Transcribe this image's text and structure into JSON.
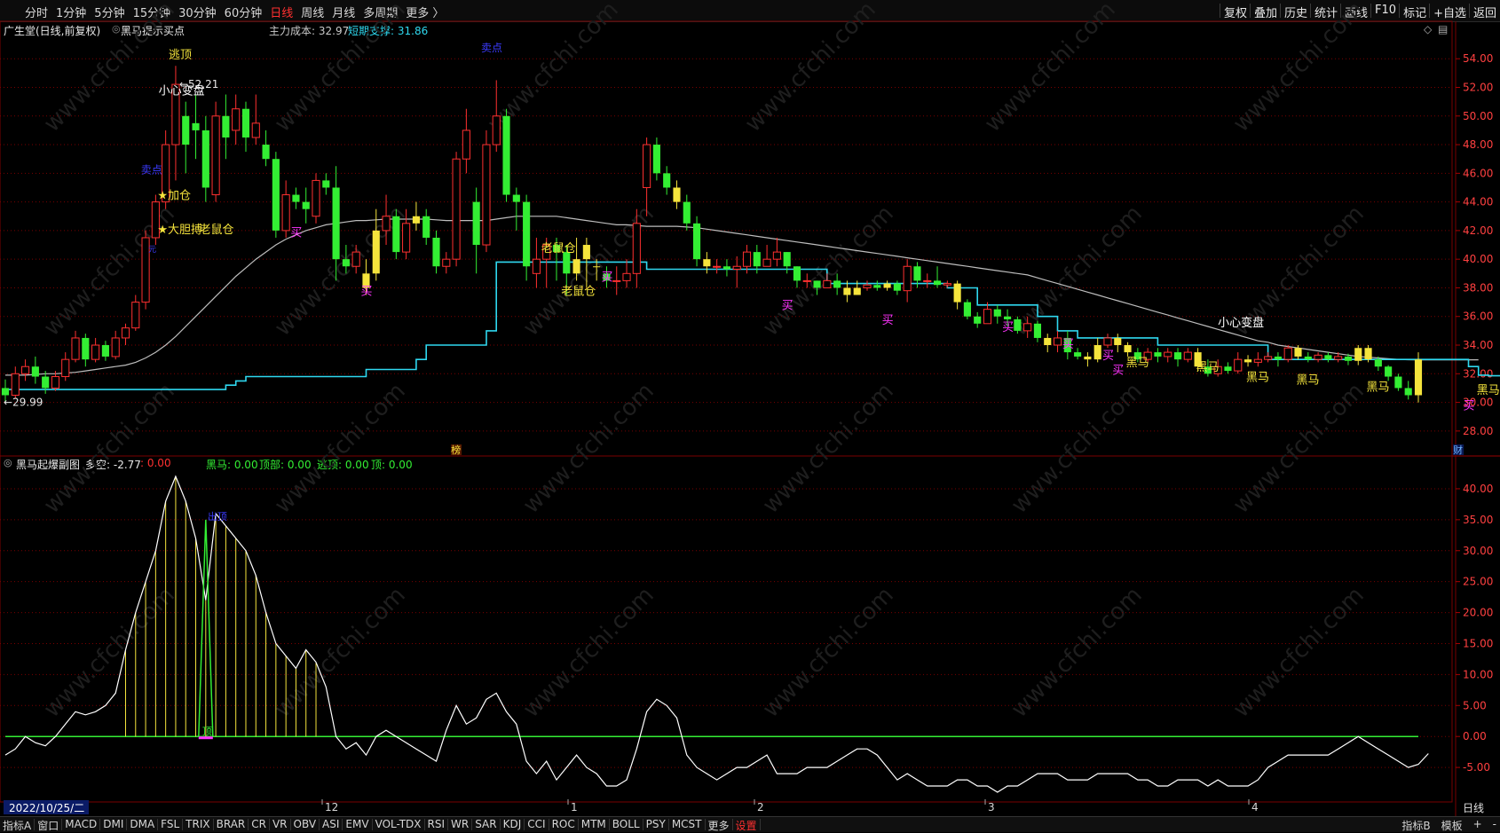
{
  "toolbar": {
    "periods": [
      "分时",
      "1分钟",
      "5分钟",
      "15分钟",
      "30分钟",
      "60分钟",
      "日线",
      "周线",
      "月线",
      "多周期",
      "更多 〉"
    ],
    "active_period": "日线",
    "right_buttons": [
      "复权",
      "叠加",
      "历史",
      "统计",
      "画线",
      "F10",
      "标记",
      "+自选",
      "返回"
    ]
  },
  "main_panel": {
    "stock_title": "广生堂(日线,前复权)",
    "indicator_name": "黑马提示买点",
    "cost_label": "主力成本: 32.97",
    "support_label": "短期支撑: 31.86",
    "price_high_marker": "52.21",
    "price_low_marker": "29.99"
  },
  "sub_panel": {
    "title": "黑马起爆副图",
    "duokong_label": "多空: -2.77",
    "zero_value": ": 0.00",
    "heima": "黑马: 0.00",
    "dingbu": "顶部: 0.00",
    "taoding": "逃顶: 0.00",
    "ding": "顶: 0.00"
  },
  "colors": {
    "up": "#ff3030",
    "down": "#33ee33",
    "yellow": "#f5e43c",
    "ma": "#bdbdbd",
    "support": "#2fd8ef",
    "grid": "#7a0000",
    "bg": "#000000"
  },
  "annotations": {
    "taoding": "逃顶",
    "xiaoxin": "小心变盘",
    "jiacang": "★加仓",
    "dadan": "★大胆搏",
    "laoshu": "老鼠仓",
    "mai": "买",
    "heima": "黑马",
    "maidian": "卖点",
    "yuan": "元",
    "bang": "榜",
    "cai": "财",
    "chuding": "出顶",
    "ding": "顶"
  },
  "xaxis": {
    "date_label": "2022/10/25/二",
    "months": [
      "12",
      "1",
      "2",
      "3",
      "4"
    ],
    "period_label": "日线"
  },
  "bottom_tabs": [
    "指标A",
    "窗口",
    "MACD",
    "DMI",
    "DMA",
    "FSL",
    "TRIX",
    "BRAR",
    "CR",
    "VR",
    "OBV",
    "ASI",
    "EMV",
    "VOL-TDX",
    "RSI",
    "WR",
    "SAR",
    "KDJ",
    "CCI",
    "ROC",
    "MTM",
    "BOLL",
    "PSY",
    "MCST",
    "更多",
    "设置"
  ],
  "bottom_right": [
    "指标B",
    "模板",
    "+",
    "-"
  ],
  "watermark": "www.cfchi.com",
  "chart_data": {
    "type": "candlestick",
    "price_axis": {
      "min": 27,
      "max": 55.5,
      "ticks": [
        28,
        30,
        32,
        34,
        36,
        38,
        40,
        42,
        44,
        46,
        48,
        50,
        52,
        54
      ]
    },
    "indicator_axis": {
      "min": -10,
      "max": 43,
      "ticks": [
        -5,
        0,
        5,
        10,
        15,
        20,
        25,
        30,
        35,
        40
      ]
    },
    "candles": [
      [
        31.0,
        30.5,
        31.6,
        29.99
      ],
      [
        30.5,
        32.0,
        32.5,
        30.3
      ],
      [
        32.0,
        32.5,
        33.0,
        31.5
      ],
      [
        32.5,
        31.8,
        33.2,
        31.3
      ],
      [
        31.8,
        31.0,
        32.2,
        30.6
      ],
      [
        31.0,
        31.8,
        32.2,
        30.8
      ],
      [
        31.8,
        33.0,
        33.5,
        31.5
      ],
      [
        33.0,
        34.5,
        35.0,
        32.8
      ],
      [
        34.5,
        33.0,
        34.8,
        32.5
      ],
      [
        33.0,
        34.0,
        34.5,
        32.8
      ],
      [
        34.0,
        33.2,
        34.3,
        32.9
      ],
      [
        33.2,
        34.5,
        35.0,
        33.0
      ],
      [
        34.5,
        35.2,
        35.5,
        34.0
      ],
      [
        35.2,
        37.0,
        37.5,
        35.0
      ],
      [
        37.0,
        41.5,
        42.0,
        36.5
      ],
      [
        41.5,
        44.0,
        44.5,
        41.0
      ],
      [
        44.0,
        48.0,
        49.0,
        43.5
      ],
      [
        48.0,
        52.21,
        53.5,
        45.5
      ],
      [
        50.0,
        48.0,
        51.0,
        46.0
      ],
      [
        49.5,
        49.0,
        51.5,
        47.0
      ],
      [
        49.0,
        45.0,
        50.0,
        44.0
      ],
      [
        44.5,
        50.0,
        51.0,
        44.0
      ],
      [
        50.0,
        48.5,
        51.5,
        47.0
      ],
      [
        49.0,
        50.5,
        51.5,
        48.0
      ],
      [
        50.5,
        48.5,
        51.0,
        47.5
      ],
      [
        48.5,
        49.5,
        51.5,
        48.0
      ],
      [
        48.0,
        47.0,
        49.0,
        46.5
      ],
      [
        47.0,
        42.0,
        47.5,
        41.5
      ],
      [
        42.0,
        44.5,
        45.5,
        41.5
      ],
      [
        44.5,
        44.0,
        45.0,
        43.5
      ],
      [
        44.0,
        43.5,
        45.0,
        42.5
      ],
      [
        43.0,
        45.5,
        46.0,
        42.5
      ],
      [
        45.5,
        45.0,
        46.0,
        44.5
      ],
      [
        45.0,
        40.0,
        46.5,
        38.5
      ],
      [
        40.0,
        39.5,
        41.0,
        39.0
      ],
      [
        39.5,
        40.5,
        41.0,
        39.0
      ],
      [
        38.0,
        39.0,
        40.0,
        37.5
      ],
      [
        39.0,
        42.0,
        43.5,
        38.5
      ],
      [
        42.0,
        43.0,
        44.5,
        41.0
      ],
      [
        43.0,
        40.5,
        43.5,
        40.0
      ],
      [
        40.5,
        42.5,
        43.5,
        40.0
      ],
      [
        42.5,
        43.0,
        44.0,
        42.0
      ],
      [
        43.0,
        41.5,
        43.5,
        41.0
      ],
      [
        41.5,
        39.5,
        42.0,
        39.0
      ],
      [
        39.5,
        40.0,
        40.5,
        39.0
      ],
      [
        40.0,
        47.0,
        47.5,
        39.5
      ],
      [
        47.0,
        49.0,
        50.5,
        46.0
      ],
      [
        44.0,
        41.0,
        45.0,
        39.0
      ],
      [
        41.0,
        48.0,
        49.0,
        40.5
      ],
      [
        48.0,
        50.0,
        52.5,
        47.5
      ],
      [
        50.0,
        44.5,
        50.5,
        44.0
      ],
      [
        44.5,
        44.0,
        45.0,
        42.0
      ],
      [
        44.0,
        39.5,
        44.5,
        38.5
      ],
      [
        39.0,
        40.0,
        41.5,
        38.0
      ],
      [
        40.0,
        41.0,
        41.5,
        38.0
      ],
      [
        41.0,
        40.5,
        41.5,
        38.5
      ],
      [
        40.5,
        39.0,
        41.0,
        37.5
      ],
      [
        39.0,
        40.0,
        41.5,
        38.5
      ],
      [
        40.0,
        41.0,
        41.5,
        38.0
      ],
      [
        39.5,
        39.5,
        40.0,
        38.5
      ],
      [
        39.0,
        38.5,
        39.5,
        38.0
      ],
      [
        38.5,
        38.5,
        39.5,
        37.5
      ],
      [
        38.5,
        39.0,
        40.0,
        38.0
      ],
      [
        39.0,
        42.5,
        43.5,
        38.0
      ],
      [
        45.0,
        48.0,
        48.5,
        43.0
      ],
      [
        48.0,
        46.0,
        48.5,
        45.5
      ],
      [
        46.0,
        45.0,
        46.5,
        44.5
      ],
      [
        45.0,
        44.0,
        45.5,
        43.5
      ],
      [
        44.0,
        42.5,
        44.5,
        42.0
      ],
      [
        42.5,
        40.0,
        43.0,
        39.5
      ],
      [
        40.0,
        39.5,
        40.5,
        39.0
      ],
      [
        39.5,
        39.5,
        40.0,
        39.0
      ],
      [
        39.5,
        39.3,
        40.0,
        38.8
      ],
      [
        39.3,
        39.5,
        40.2,
        38.0
      ],
      [
        39.5,
        40.5,
        41.0,
        39.0
      ],
      [
        40.5,
        39.5,
        41.0,
        39.0
      ],
      [
        39.5,
        40.0,
        41.0,
        39.5
      ],
      [
        40.0,
        40.5,
        41.5,
        39.5
      ],
      [
        40.5,
        39.5,
        40.5,
        39.0
      ],
      [
        39.5,
        38.5,
        39.5,
        38.0
      ],
      [
        38.5,
        38.5,
        39.0,
        38.0
      ],
      [
        38.5,
        38.0,
        38.5,
        37.5
      ],
      [
        38.0,
        38.5,
        39.0,
        38.0
      ],
      [
        38.5,
        38.0,
        39.0,
        37.5
      ],
      [
        38.0,
        37.5,
        38.5,
        37.0
      ],
      [
        37.5,
        38.0,
        38.5,
        37.5
      ],
      [
        38.0,
        38.2,
        38.5,
        37.8
      ],
      [
        38.2,
        38.0,
        38.5,
        37.8
      ],
      [
        38.0,
        38.3,
        38.5,
        37.8
      ],
      [
        38.3,
        37.8,
        38.5,
        37.5
      ],
      [
        37.8,
        39.5,
        40.0,
        37.0
      ],
      [
        39.5,
        38.5,
        39.8,
        38.0
      ],
      [
        38.5,
        38.5,
        39.0,
        38.0
      ],
      [
        38.5,
        38.2,
        39.5,
        38.0
      ],
      [
        38.2,
        38.3,
        38.5,
        38.0
      ],
      [
        38.3,
        37.0,
        38.5,
        36.5
      ],
      [
        37.0,
        36.0,
        37.2,
        35.8
      ],
      [
        36.0,
        35.5,
        36.3,
        35.2
      ],
      [
        35.5,
        36.5,
        37.0,
        35.5
      ],
      [
        36.5,
        36.0,
        36.8,
        35.5
      ],
      [
        36.0,
        35.8,
        36.5,
        35.3
      ],
      [
        35.8,
        35.0,
        36.0,
        34.8
      ],
      [
        35.0,
        35.5,
        36.0,
        34.5
      ],
      [
        35.5,
        34.5,
        35.7,
        34.2
      ],
      [
        34.5,
        34.0,
        34.8,
        33.5
      ],
      [
        34.0,
        34.5,
        35.0,
        33.5
      ],
      [
        34.5,
        33.5,
        35.0,
        33.0
      ],
      [
        33.5,
        33.2,
        33.8,
        33.0
      ],
      [
        33.2,
        33.0,
        33.5,
        32.5
      ],
      [
        33.0,
        34.0,
        34.5,
        32.8
      ],
      [
        34.0,
        34.5,
        34.8,
        33.8
      ],
      [
        34.5,
        34.0,
        34.8,
        33.5
      ],
      [
        34.0,
        33.5,
        34.2,
        33.2
      ],
      [
        33.5,
        33.0,
        33.8,
        32.8
      ],
      [
        33.0,
        33.5,
        33.8,
        32.8
      ],
      [
        33.5,
        33.2,
        33.8,
        32.8
      ],
      [
        33.2,
        33.5,
        33.8,
        32.8
      ],
      [
        33.5,
        33.0,
        33.8,
        32.5
      ],
      [
        33.0,
        33.5,
        33.8,
        32.8
      ],
      [
        33.5,
        32.5,
        33.8,
        32.2
      ],
      [
        32.5,
        32.0,
        33.0,
        31.8
      ],
      [
        32.0,
        32.5,
        33.0,
        31.8
      ],
      [
        32.5,
        32.2,
        32.8,
        32.0
      ],
      [
        32.2,
        33.0,
        33.5,
        32.0
      ],
      [
        33.0,
        32.8,
        33.3,
        32.5
      ],
      [
        32.8,
        33.0,
        33.5,
        32.5
      ],
      [
        33.0,
        33.2,
        33.5,
        32.8
      ],
      [
        33.2,
        33.0,
        33.5,
        32.5
      ],
      [
        33.0,
        33.8,
        34.0,
        32.8
      ],
      [
        33.8,
        33.2,
        34.0,
        33.0
      ],
      [
        33.2,
        33.0,
        33.5,
        32.8
      ],
      [
        33.0,
        33.3,
        33.5,
        32.8
      ],
      [
        33.3,
        33.0,
        33.5,
        32.8
      ],
      [
        33.0,
        33.2,
        33.5,
        32.8
      ],
      [
        33.2,
        32.9,
        33.4,
        32.6
      ],
      [
        32.9,
        33.8,
        34.0,
        32.6
      ],
      [
        33.8,
        33.0,
        34.0,
        32.8
      ],
      [
        33.0,
        32.5,
        33.2,
        32.2
      ],
      [
        32.5,
        31.8,
        32.6,
        31.5
      ],
      [
        31.8,
        31.0,
        32.0,
        30.8
      ],
      [
        31.0,
        30.5,
        31.5,
        30.2
      ],
      [
        30.5,
        33.0,
        33.5,
        29.99
      ]
    ],
    "candle_color_override": {
      "yellow": [
        36,
        37,
        41,
        57,
        58,
        59,
        67,
        70,
        84,
        85,
        88,
        95,
        104,
        108,
        109,
        111,
        112,
        119,
        124,
        129,
        135,
        136,
        141,
        145,
        146,
        149
      ],
      "green_force": [
        5,
        7,
        12,
        15,
        16
      ]
    },
    "ma_line": [
      31.9,
      31.9,
      31.9,
      31.95,
      32.0,
      32.0,
      32.05,
      32.1,
      32.2,
      32.3,
      32.4,
      32.5,
      32.6,
      32.8,
      33.1,
      33.5,
      34.0,
      34.6,
      35.3,
      36.0,
      36.7,
      37.4,
      38.1,
      38.8,
      39.4,
      40.0,
      40.5,
      41.0,
      41.4,
      41.7,
      42.0,
      42.2,
      42.4,
      42.5,
      42.6,
      42.7,
      42.7,
      42.75,
      42.8,
      42.8,
      42.8,
      42.8,
      42.8,
      42.75,
      42.7,
      42.7,
      42.7,
      42.7,
      42.7,
      42.8,
      42.9,
      43.0,
      43.0,
      43.0,
      43.0,
      43.0,
      42.9,
      42.8,
      42.7,
      42.6,
      42.5,
      42.4,
      42.4,
      42.35,
      42.3,
      42.3,
      42.3,
      42.3,
      42.25,
      42.2,
      42.1,
      42.0,
      41.9,
      41.8,
      41.7,
      41.6,
      41.5,
      41.4,
      41.3,
      41.2,
      41.1,
      41.0,
      40.9,
      40.8,
      40.7,
      40.6,
      40.5,
      40.4,
      40.3,
      40.2,
      40.1,
      40.0,
      39.9,
      39.8,
      39.7,
      39.6,
      39.5,
      39.4,
      39.3,
      39.2,
      39.1,
      39.0,
      38.9,
      38.7,
      38.5,
      38.3,
      38.1,
      37.9,
      37.7,
      37.5,
      37.3,
      37.1,
      36.9,
      36.7,
      36.5,
      36.3,
      36.1,
      35.9,
      35.7,
      35.5,
      35.3,
      35.1,
      34.9,
      34.7,
      34.5,
      34.3,
      34.2,
      34.0,
      33.9,
      33.8,
      33.7,
      33.6,
      33.5,
      33.4,
      33.3,
      33.2,
      33.15,
      33.1,
      33.05,
      33.0,
      32.98,
      32.97,
      32.97,
      32.97,
      32.97,
      32.97,
      32.97,
      32.97
    ],
    "support_line": [
      30.9,
      30.9,
      30.9,
      30.9,
      30.9,
      30.9,
      30.9,
      30.9,
      30.9,
      30.9,
      30.9,
      30.9,
      30.9,
      30.9,
      30.9,
      30.9,
      30.9,
      30.9,
      30.9,
      30.9,
      30.9,
      30.9,
      31.2,
      31.5,
      31.8,
      31.8,
      31.8,
      31.8,
      31.8,
      31.8,
      31.8,
      31.8,
      31.8,
      31.8,
      31.8,
      31.8,
      32.3,
      32.3,
      32.3,
      32.3,
      32.3,
      33.0,
      34.0,
      34.0,
      34.0,
      34.0,
      34.0,
      34.0,
      35.0,
      39.8,
      39.8,
      39.8,
      39.8,
      39.8,
      39.8,
      39.8,
      39.8,
      39.8,
      39.8,
      39.8,
      39.8,
      39.8,
      39.8,
      39.8,
      39.3,
      39.3,
      39.3,
      39.3,
      39.3,
      39.3,
      39.3,
      39.3,
      39.3,
      39.3,
      39.3,
      39.3,
      39.3,
      39.3,
      39.3,
      39.3,
      39.3,
      39.3,
      38.3,
      38.3,
      38.3,
      38.3,
      38.3,
      38.3,
      38.3,
      38.3,
      38.3,
      38.3,
      38.3,
      38.3,
      38.0,
      38.0,
      38.0,
      36.8,
      36.8,
      36.8,
      36.8,
      36.8,
      36.8,
      36.0,
      36.0,
      35.0,
      35.0,
      34.5,
      34.5,
      34.5,
      34.5,
      34.5,
      34.5,
      34.5,
      34.5,
      34.0,
      34.0,
      34.0,
      34.0,
      34.0,
      34.0,
      34.0,
      34.0,
      34.0,
      34.0,
      34.0,
      33.0,
      33.0,
      33.0,
      33.0,
      33.0,
      33.0,
      33.0,
      33.0,
      33.0,
      33.0,
      33.0,
      33.0,
      33.0,
      33.0,
      33.0,
      33.0,
      33.0,
      33.0,
      33.0,
      33.0,
      32.5,
      31.9,
      31.86,
      31.86,
      31.86,
      31.86
    ],
    "duokong": [
      -3,
      -2,
      0,
      -1,
      -1.5,
      0,
      2,
      4,
      3.5,
      4,
      5,
      7,
      14,
      20,
      25,
      30,
      38,
      42,
      38,
      32,
      22,
      36,
      34,
      32,
      30,
      26,
      20,
      15,
      13,
      11,
      14,
      12,
      8,
      0,
      -2,
      -1,
      -3,
      0,
      1,
      0,
      -1,
      -2,
      -3,
      -4,
      1,
      5,
      2,
      3,
      6,
      7,
      4,
      2,
      -4,
      -6,
      -4,
      -7,
      -5,
      -3,
      -5,
      -6,
      -8,
      -8,
      -7,
      -2,
      4,
      6,
      5,
      3,
      -3,
      -5,
      -6,
      -7,
      -6,
      -5,
      -5,
      -4,
      -3,
      -6,
      -6,
      -6,
      -5,
      -5,
      -5,
      -4,
      -3,
      -2,
      -2,
      -3,
      -5,
      -7,
      -6,
      -7,
      -8,
      -8,
      -8,
      -7,
      -7,
      -8,
      -8,
      -9,
      -8,
      -8,
      -7,
      -6,
      -6,
      -6,
      -7,
      -7,
      -7,
      -6,
      -6,
      -6,
      -6,
      -7,
      -7,
      -8,
      -8,
      -7,
      -7,
      -7,
      -8,
      -7,
      -8,
      -8,
      -8,
      -7,
      -5,
      -4,
      -3,
      -3,
      -3,
      -3,
      -3,
      -2,
      -1,
      0,
      -1,
      -2,
      -3,
      -4,
      -5,
      -4.5,
      -2.77
    ],
    "heima_spike_index": 20
  }
}
